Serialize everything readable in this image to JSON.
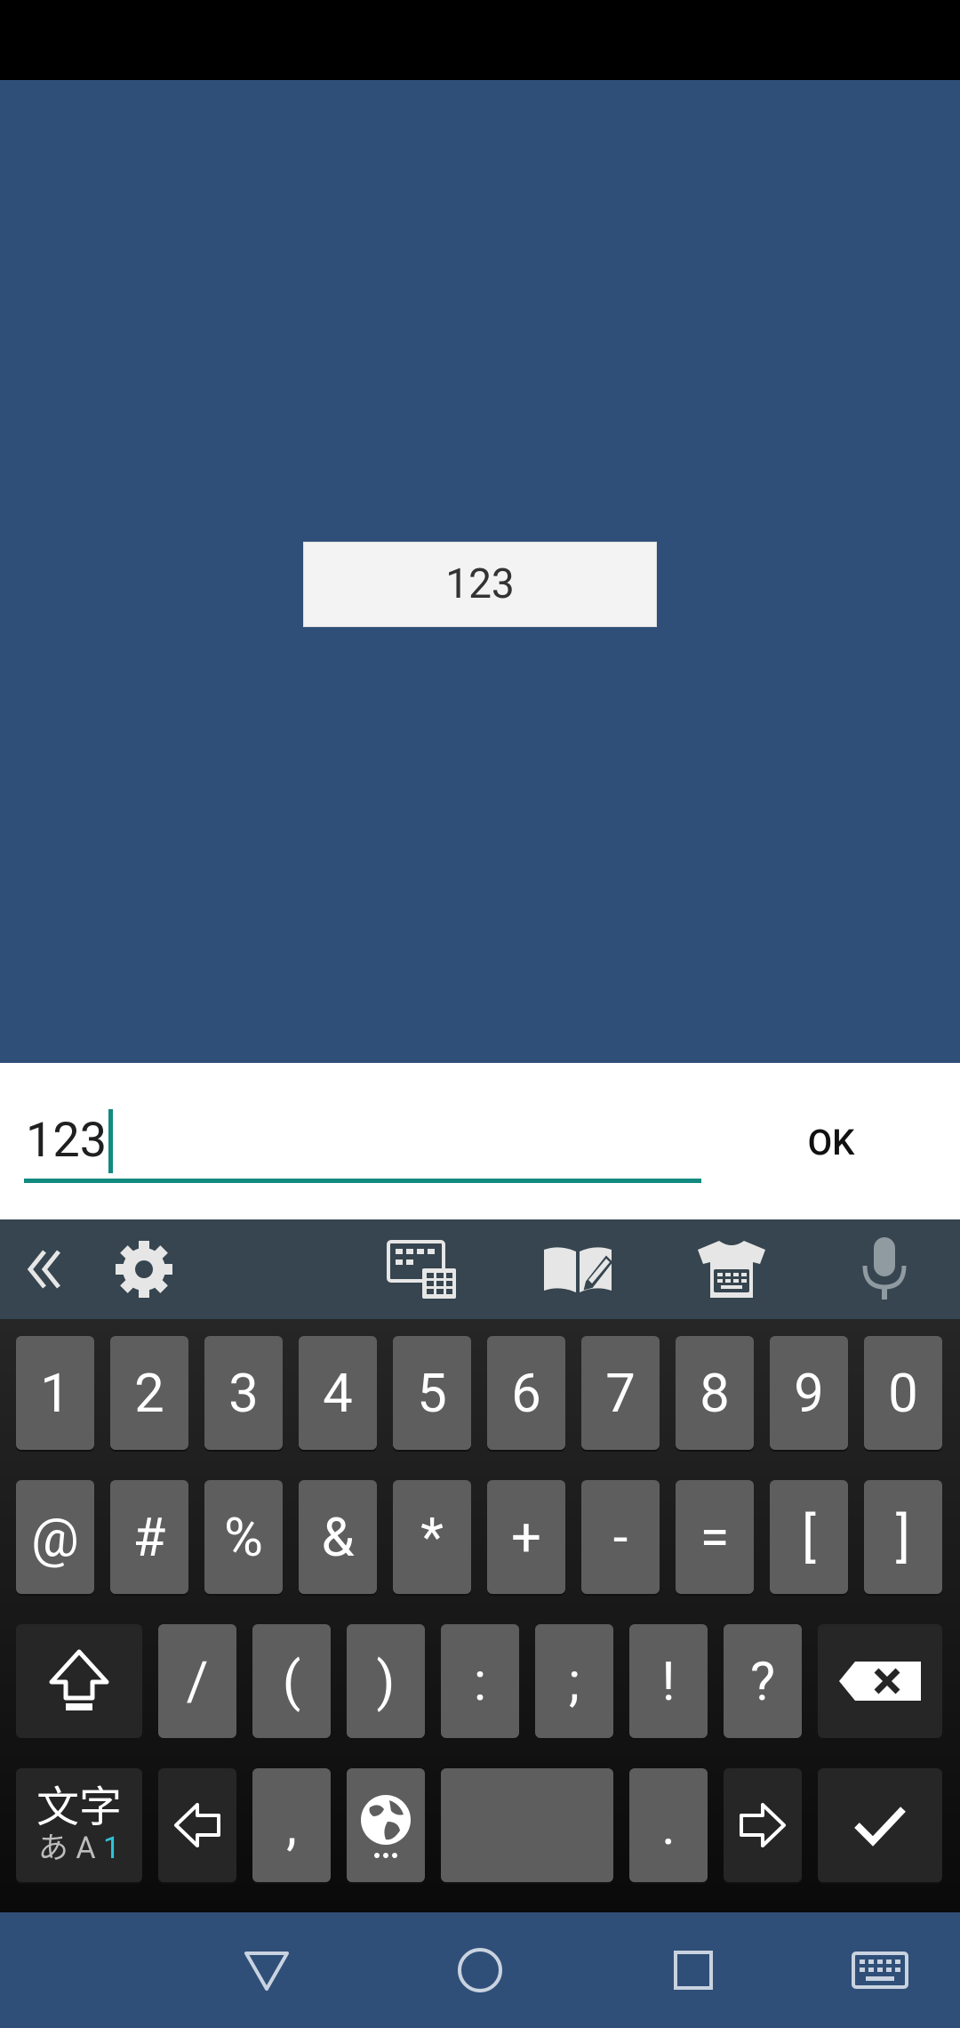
{
  "app": {
    "display_value": "123"
  },
  "input": {
    "value": "123",
    "ok_label": "OK"
  },
  "toolbar": {
    "icons": [
      "collapse-icon",
      "gear-icon",
      "keyboard-grid-icon",
      "dictionary-edit-icon",
      "theme-shirt-icon",
      "microphone-icon"
    ]
  },
  "keyboard": {
    "row1": [
      "1",
      "2",
      "3",
      "4",
      "5",
      "6",
      "7",
      "8",
      "9",
      "0"
    ],
    "row2": [
      "@",
      "#",
      "%",
      "&",
      "*",
      "+",
      "-",
      "=",
      "[",
      "]"
    ],
    "row3": [
      "/",
      "(",
      ")",
      ":",
      ";",
      "!",
      "?"
    ],
    "mode_key": {
      "line1": "文字",
      "hira": "あ",
      "alpha": "A",
      "num": "1"
    },
    "comma": ",",
    "period": "."
  },
  "colors": {
    "app_bg": "#304f78",
    "accent": "#128a80",
    "key_bg": "#5e5e5e"
  }
}
